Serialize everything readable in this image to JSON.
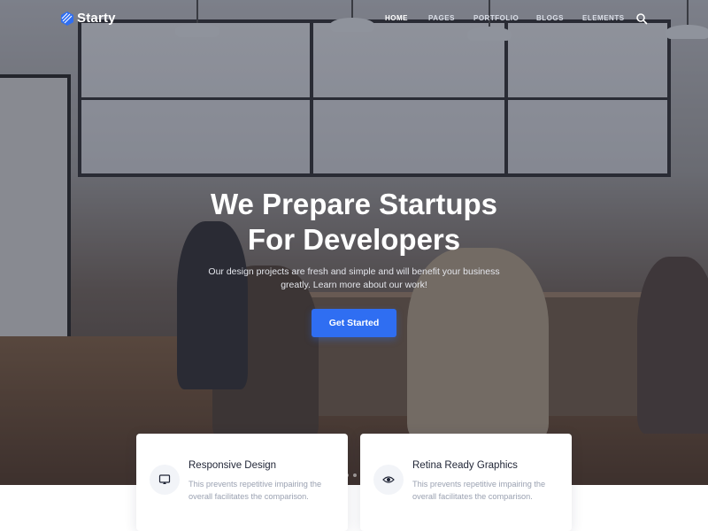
{
  "brand": {
    "name": "Starty",
    "logo_icon": "striped-hexagon-logo",
    "accent_color": "#2f6ef2"
  },
  "nav": {
    "items": [
      {
        "label": "HOME",
        "active": true
      },
      {
        "label": "PAGES",
        "active": false
      },
      {
        "label": "PORTFOLIO",
        "active": false
      },
      {
        "label": "BLOGS",
        "active": false
      },
      {
        "label": "ELEMENTS",
        "active": false
      }
    ],
    "search_icon": "search-icon"
  },
  "hero": {
    "title_line1": "We Prepare Startups",
    "title_line2": "For Developers",
    "subtitle_line1": "Our design projects are fresh and simple and will benefit your business",
    "subtitle_line2": "greatly. Learn more about our work!",
    "cta_label": "Get Started",
    "slider_dots": 3,
    "active_dot": 2
  },
  "features": [
    {
      "icon": "monitor-icon",
      "title": "Responsive Design",
      "text_line1": "This prevents repetitive impairing the",
      "text_line2": "overall facilitates the comparison."
    },
    {
      "icon": "eye-icon",
      "title": "Retina Ready Graphics",
      "text_line1": "This prevents repetitive impairing the",
      "text_line2": "overall facilitates the comparison."
    }
  ]
}
